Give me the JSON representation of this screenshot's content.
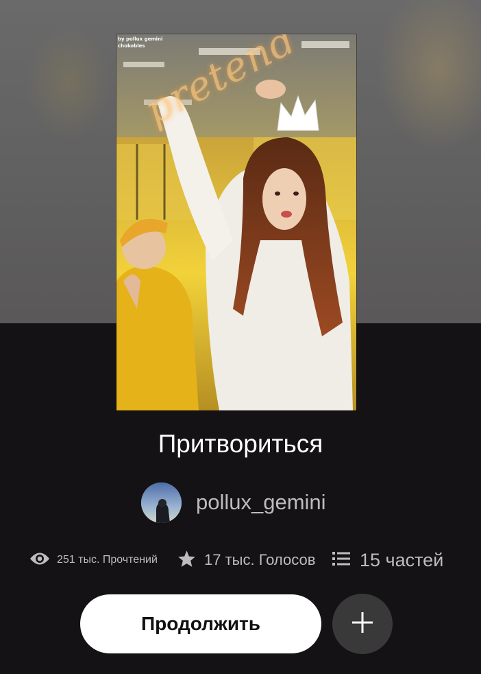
{
  "cover": {
    "credit_line1": "by pollux gemini",
    "credit_line2": "chokobles",
    "cover_word": "pretend"
  },
  "story": {
    "title": "Притвориться"
  },
  "author": {
    "name": "pollux_gemini"
  },
  "stats": {
    "reads": "251 тыс. Прочтений",
    "votes": "17 тыс. Голосов",
    "parts": "15 частей"
  },
  "actions": {
    "continue_label": "Продолжить"
  },
  "icons": {
    "reads": "eye-icon",
    "votes": "star-icon",
    "parts": "list-icon",
    "add": "plus-icon"
  },
  "colors": {
    "background": "#141214",
    "button_primary": "#ffffff",
    "button_secondary": "#3a393a",
    "muted_text": "#bdbdbd"
  }
}
